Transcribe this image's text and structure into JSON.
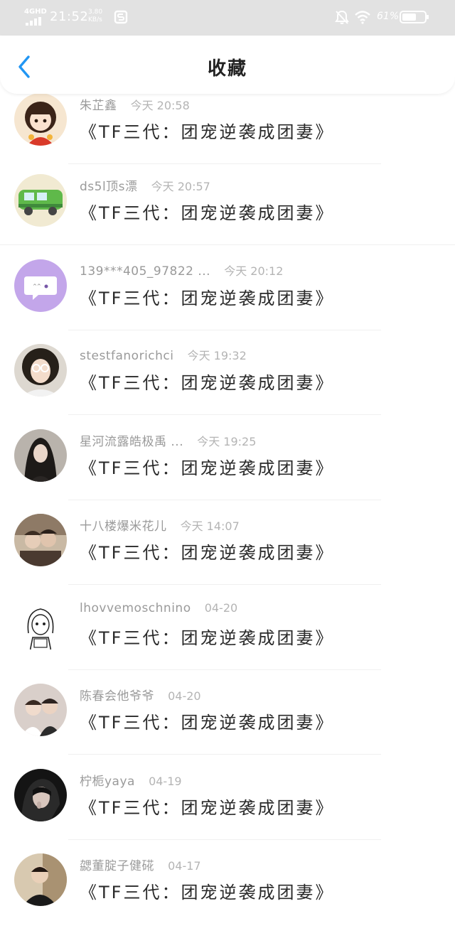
{
  "status": {
    "network": "4GHD",
    "time": "21:52",
    "speed_value": "3.80",
    "speed_unit": "KB/s",
    "battery": "61%"
  },
  "nav": {
    "title": "收藏"
  },
  "messages": [
    {
      "user": "朱芷鑫",
      "time": "今天 20:58",
      "text": "《TF三代：团宠逆袭成团妻》"
    },
    {
      "user": "ds5l顶s漂",
      "time": "今天 20:57",
      "text": "《TF三代：团宠逆袭成团妻》"
    },
    {
      "user": "139***405_97822 ...",
      "time": "今天 20:12",
      "text": "《TF三代：团宠逆袭成团妻》"
    },
    {
      "user": "stestfanorichci",
      "time": "今天 19:32",
      "text": "《TF三代：团宠逆袭成团妻》"
    },
    {
      "user": "星河流露皓极禹 ...",
      "time": "今天 19:25",
      "text": "《TF三代：团宠逆袭成团妻》"
    },
    {
      "user": "十八楼爆米花儿",
      "time": "今天 14:07",
      "text": "《TF三代：团宠逆袭成团妻》"
    },
    {
      "user": "lhovvemoschnino",
      "time": "04-20",
      "text": "《TF三代：团宠逆袭成团妻》"
    },
    {
      "user": "陈春会他爷爷",
      "time": "04-20",
      "text": "《TF三代：团宠逆袭成团妻》"
    },
    {
      "user": "柠栀yaya",
      "time": "04-19",
      "text": "《TF三代：团宠逆袭成团妻》"
    },
    {
      "user": "勰董腚子健硴",
      "time": "04-17",
      "text": "《TF三代：团宠逆袭成团妻》"
    }
  ]
}
